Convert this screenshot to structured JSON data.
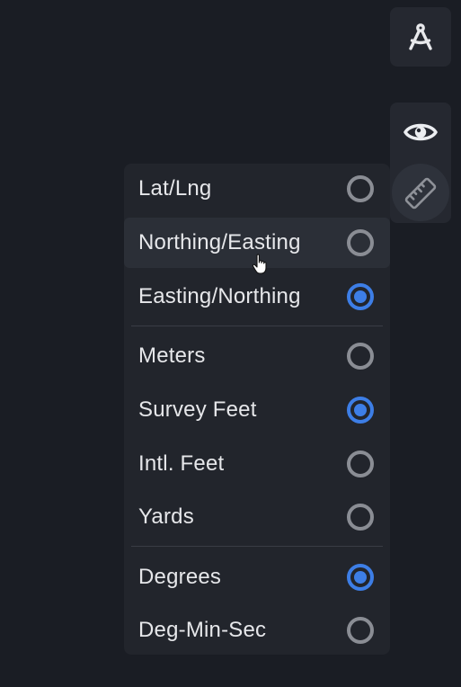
{
  "toolbar": {
    "drafting_icon": "drafting-compass-icon",
    "eye_icon": "eye-icon",
    "ruler_icon": "ruler-icon"
  },
  "menu": {
    "groups": [
      {
        "name": "coordinate-format",
        "items": [
          {
            "label": "Lat/Lng",
            "checked": false
          },
          {
            "label": "Northing/Easting",
            "checked": false,
            "hovered": true
          },
          {
            "label": "Easting/Northing",
            "checked": true
          }
        ]
      },
      {
        "name": "distance-unit",
        "items": [
          {
            "label": "Meters",
            "checked": false
          },
          {
            "label": "Survey Feet",
            "checked": true
          },
          {
            "label": "Intl. Feet",
            "checked": false
          },
          {
            "label": "Yards",
            "checked": false
          }
        ]
      },
      {
        "name": "angle-format",
        "items": [
          {
            "label": "Degrees",
            "checked": true
          },
          {
            "label": "Deg-Min-Sec",
            "checked": false
          }
        ]
      }
    ]
  },
  "colors": {
    "background": "#1a1d24",
    "panel": "#22252c",
    "accent": "#3d7ee6",
    "radio_unchecked": "#8a8d94"
  }
}
